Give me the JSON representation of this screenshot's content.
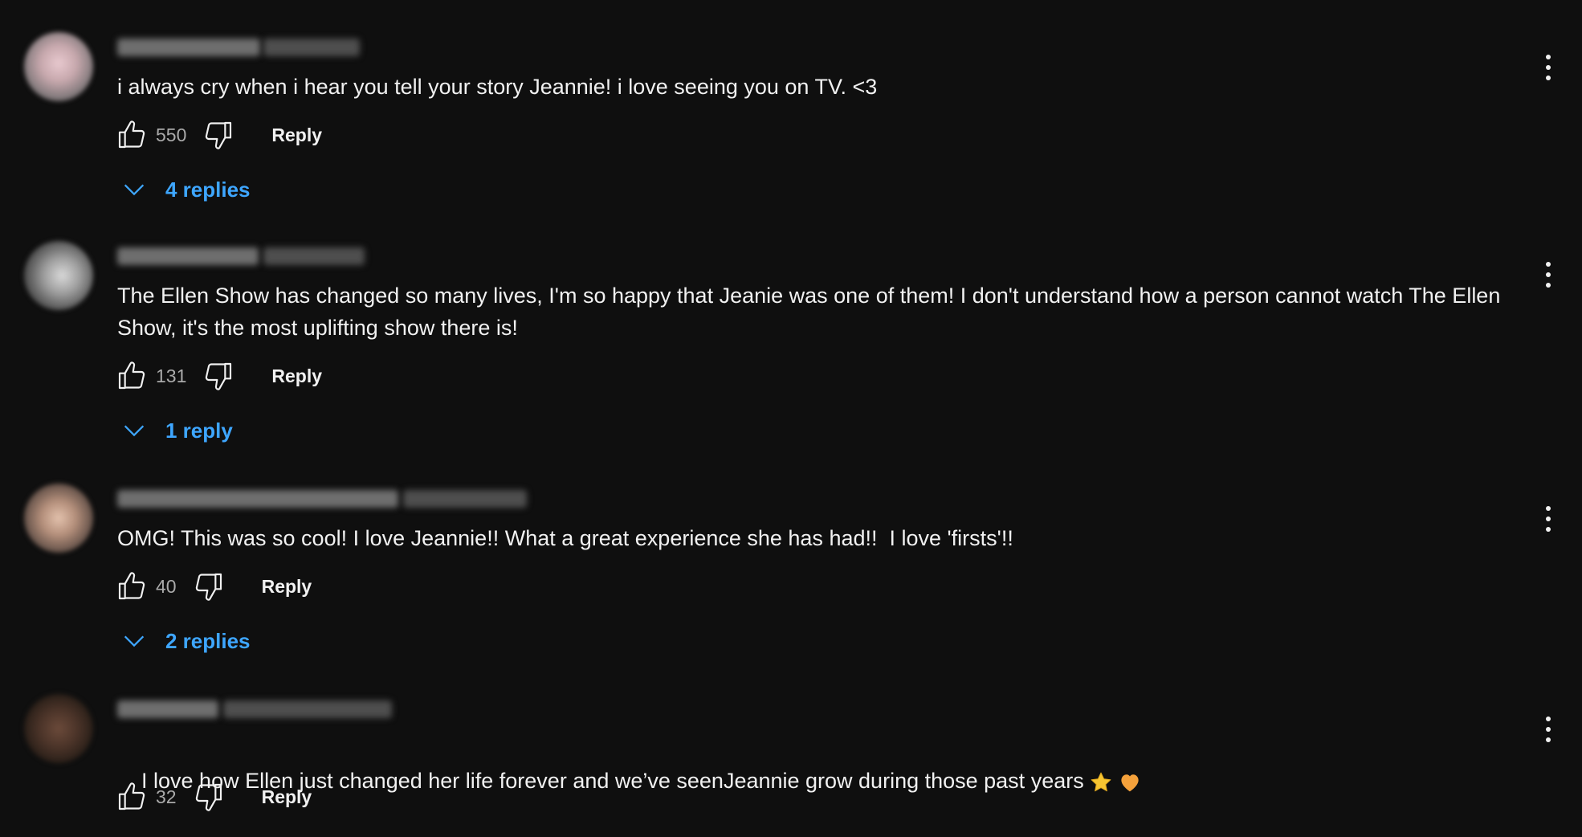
{
  "comments": [
    {
      "text": "i always cry when i hear you tell your story Jeannie! i love seeing you on TV. <3",
      "likes": "550",
      "reply_label": "Reply",
      "replies_label": "4 replies"
    },
    {
      "text": "The Ellen Show has changed so many lives, I'm so happy that Jeanie was one of them! I don't understand how a person cannot watch The Ellen Show, it's the most uplifting show there is!",
      "likes": "131",
      "reply_label": "Reply",
      "replies_label": "1 reply"
    },
    {
      "text": "OMG! This was so cool! I love Jeannie!! What a great experience she has had!!  I love 'firsts'!!",
      "likes": "40",
      "reply_label": "Reply",
      "replies_label": "2 replies"
    },
    {
      "text": "I love how Ellen just changed her life forever and we’ve seenJeannie grow during those past years",
      "likes": "32",
      "reply_label": "Reply",
      "emojis": [
        "star-emoji",
        "orange-heart-emoji"
      ]
    }
  ],
  "icons": {
    "like": "thumbs-up-icon",
    "dislike": "thumbs-down-icon",
    "expand": "chevron-down-icon",
    "menu": "more-vertical-icon"
  },
  "colors": {
    "background": "#0f0f0f",
    "text": "#f1f1f1",
    "secondary_text": "#aaaaaa",
    "link": "#3ea6ff"
  }
}
